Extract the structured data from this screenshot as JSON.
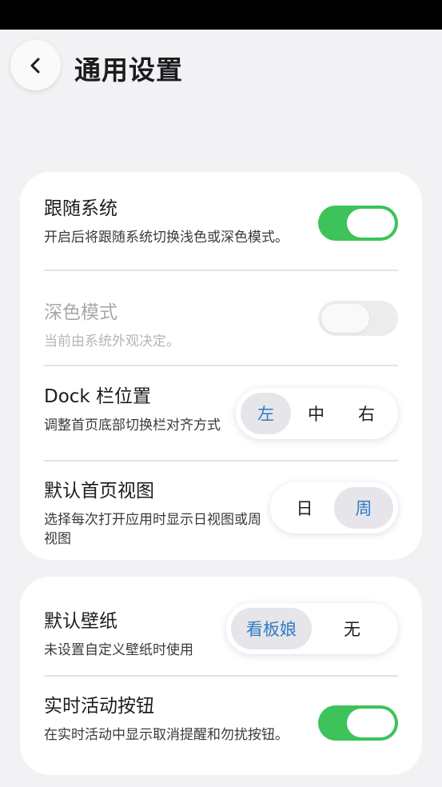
{
  "header": {
    "title": "通用设置"
  },
  "sections": {
    "display": {
      "follow_system": {
        "title": "跟随系统",
        "desc": "开启后将跟随系统切换浅色或深色模式。",
        "enabled": true
      },
      "dark_mode": {
        "title": "深色模式",
        "desc": "当前由系统外观决定。",
        "enabled": false,
        "disabled": true
      },
      "dock_position": {
        "title": "Dock 栏位置",
        "desc": "调整首页底部切换栏对齐方式",
        "options": [
          "左",
          "中",
          "右"
        ],
        "selected": "左"
      },
      "default_view": {
        "title": "默认首页视图",
        "desc": "选择每次打开应用时显示日视图或周视图",
        "options": [
          "日",
          "周"
        ],
        "selected": "周"
      }
    },
    "misc": {
      "default_wallpaper": {
        "title": "默认壁纸",
        "desc": "未设置自定义壁纸时使用",
        "options": [
          "看板娘",
          "无"
        ],
        "selected": "看板娘"
      },
      "live_activity_button": {
        "title": "实时活动按钮",
        "desc": "在实时活动中显示取消提醒和勿扰按钮。",
        "enabled": true
      }
    }
  },
  "colors": {
    "toggle_on": "#3dc35a",
    "accent_text": "#2f7bc4",
    "background": "#f2f2f4"
  }
}
